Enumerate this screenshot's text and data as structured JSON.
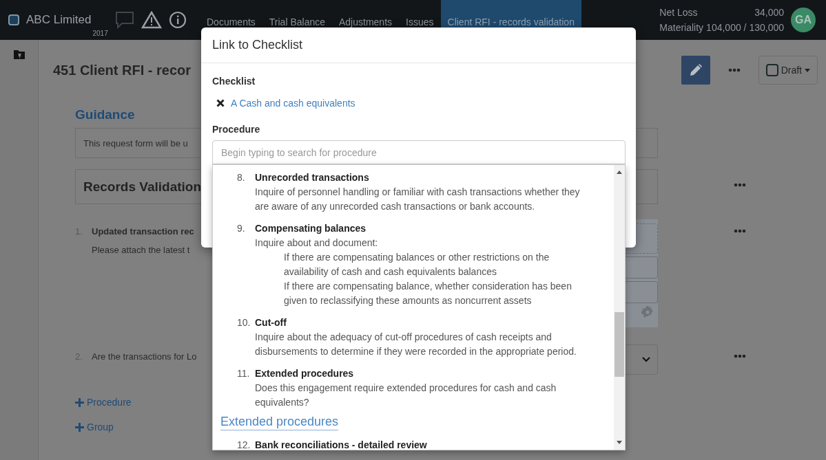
{
  "top_bar": {
    "company": "ABC Limited",
    "year": "2017",
    "nav": [
      {
        "label": "Documents",
        "selected": false
      },
      {
        "label": "Trial Balance",
        "selected": false
      },
      {
        "label": "Adjustments",
        "selected": false
      },
      {
        "label": "Issues",
        "selected": false
      },
      {
        "label": "Client RFI - records validation",
        "selected": true
      }
    ],
    "net_loss_label": "Net Loss",
    "net_loss_value": "34,000",
    "materiality_label": "Materiality",
    "materiality_value": "104,000 / 130,000",
    "avatar": "GA"
  },
  "page": {
    "title": "451 Client RFI - recor",
    "status": {
      "label": "Draft",
      "checked": false
    },
    "guidance_heading": "Guidance",
    "guidance_text": "This request form will be u",
    "group_title": "Records Validation",
    "items": [
      {
        "number": "1.",
        "title": "Updated transaction rec",
        "text": "Please attach the latest t"
      },
      {
        "number": "2.",
        "text": "Are the transactions for Lo"
      }
    ],
    "add_links": [
      "Procedure",
      "Group"
    ]
  },
  "modal": {
    "title": "Link to Checklist",
    "checklist_label": "Checklist",
    "checklist_value": "A Cash and cash equivalents",
    "procedure_label": "Procedure",
    "procedure_placeholder": "Begin typing to search for procedure",
    "results": [
      {
        "kind": "procedure",
        "number": "8.",
        "title": "Unrecorded transactions",
        "text": "Inquire of personnel handling or familiar with cash transactions whether they are aware of any unrecorded cash transactions or bank accounts."
      },
      {
        "kind": "procedure",
        "number": "9.",
        "title": "Compensating balances",
        "text": "Inquire about and document:",
        "subitems": [
          "If there are compensating balances or other restrictions on the availability of cash and cash equivalents balances",
          "If there are compensating balance, whether consideration has been given to reclassifying these amounts as noncurrent assets"
        ]
      },
      {
        "kind": "procedure",
        "number": "10.",
        "title": "Cut-off",
        "text": "Inquire about the adequacy of cut-off procedures of cash receipts and disbursements to determine if they were recorded in the appropriate period."
      },
      {
        "kind": "procedure",
        "number": "11.",
        "title": "Extended procedures",
        "text": "Does this engagement require extended procedures for cash and cash equivalents?"
      },
      {
        "kind": "section",
        "title": "Extended procedures"
      },
      {
        "kind": "procedure",
        "number": "12.",
        "title": "Bank reconciliations - detailed review"
      }
    ]
  }
}
